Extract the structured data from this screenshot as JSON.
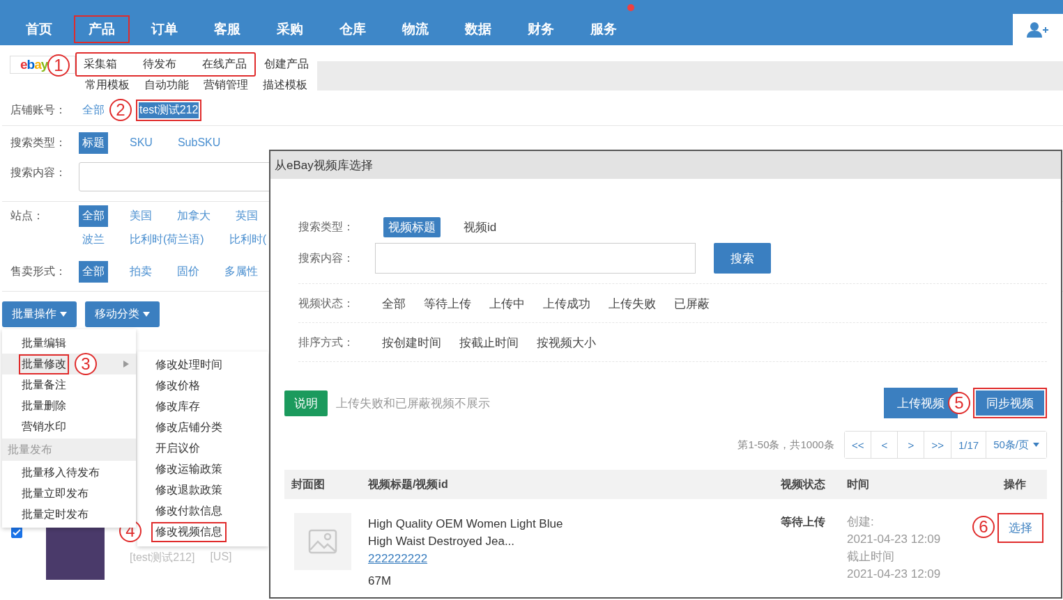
{
  "top_nav": {
    "items": [
      {
        "label": "首页",
        "boxed": false,
        "dot": false
      },
      {
        "label": "产品",
        "boxed": true,
        "dot": false
      },
      {
        "label": "订单",
        "boxed": false,
        "dot": false
      },
      {
        "label": "客服",
        "boxed": false,
        "dot": false
      },
      {
        "label": "采购",
        "boxed": false,
        "dot": false
      },
      {
        "label": "仓库",
        "boxed": false,
        "dot": false
      },
      {
        "label": "物流",
        "boxed": false,
        "dot": false
      },
      {
        "label": "数据",
        "boxed": false,
        "dot": false
      },
      {
        "label": "财务",
        "boxed": false,
        "dot": false
      },
      {
        "label": "服务",
        "boxed": false,
        "dot": true
      }
    ]
  },
  "platform_logo": "ebay",
  "sub_nav": {
    "callout": "1",
    "rows": [
      [
        {
          "label": "采集箱",
          "boxed": true
        },
        {
          "label": "待发布",
          "boxed": true
        },
        {
          "label": "在线产品",
          "boxed": true
        },
        {
          "label": "创建产品",
          "boxed": false
        }
      ],
      [
        {
          "label": "常用模板",
          "boxed": false
        },
        {
          "label": "自动功能",
          "boxed": false
        },
        {
          "label": "营销管理",
          "boxed": false
        },
        {
          "label": "描述模板",
          "boxed": false
        }
      ]
    ]
  },
  "filters": [
    {
      "kind": "options",
      "label": "店铺账号：",
      "option_rows": [
        [
          {
            "text": "全部",
            "selected": false,
            "boxed": false
          },
          {
            "text": "test测试212",
            "selected": true,
            "boxed": true,
            "callout": "2"
          }
        ]
      ]
    },
    {
      "kind": "options",
      "label": "搜索类型：",
      "option_rows": [
        [
          {
            "text": "标题",
            "selected": true,
            "boxed": false
          },
          {
            "text": "SKU",
            "selected": false,
            "boxed": false
          },
          {
            "text": "SubSKU",
            "selected": false,
            "boxed": false
          }
        ]
      ]
    },
    {
      "kind": "input",
      "label": "搜索内容："
    },
    {
      "kind": "options",
      "label": "站点：",
      "option_rows": [
        [
          {
            "text": "全部",
            "selected": true,
            "boxed": false
          },
          {
            "text": "美国",
            "selected": false,
            "boxed": false
          },
          {
            "text": "加拿大",
            "selected": false,
            "boxed": false
          },
          {
            "text": "英国",
            "selected": false,
            "boxed": false
          }
        ],
        [
          {
            "text": "波兰",
            "selected": false,
            "boxed": false
          },
          {
            "text": "比利时(荷兰语)",
            "selected": false,
            "boxed": false
          },
          {
            "text": "比利时(",
            "selected": false,
            "boxed": false
          }
        ]
      ]
    },
    {
      "kind": "options",
      "label": "售卖形式：",
      "option_rows": [
        [
          {
            "text": "全部",
            "selected": true,
            "boxed": false
          },
          {
            "text": "拍卖",
            "selected": false,
            "boxed": false
          },
          {
            "text": "固价",
            "selected": false,
            "boxed": false
          },
          {
            "text": "多属性",
            "selected": false,
            "boxed": false
          }
        ]
      ]
    }
  ],
  "bulk_buttons": [
    {
      "label": "批量操作"
    },
    {
      "label": "移动分类"
    }
  ],
  "bulk_menu": {
    "items": [
      {
        "kind": "item",
        "text": "批量编辑",
        "highlighted": false,
        "boxed": false,
        "submenu": false
      },
      {
        "kind": "item",
        "text": "批量修改",
        "highlighted": true,
        "boxed": true,
        "submenu": true,
        "callout": "3"
      },
      {
        "kind": "item",
        "text": "批量备注",
        "highlighted": false,
        "boxed": false,
        "submenu": false
      },
      {
        "kind": "item",
        "text": "批量删除",
        "highlighted": false,
        "boxed": false,
        "submenu": false
      },
      {
        "kind": "item",
        "text": "营销水印",
        "highlighted": false,
        "boxed": false,
        "submenu": false
      },
      {
        "kind": "header",
        "text": "批量发布"
      },
      {
        "kind": "item",
        "text": "批量移入待发布",
        "highlighted": false,
        "boxed": false,
        "submenu": false
      },
      {
        "kind": "item",
        "text": "批量立即发布",
        "highlighted": false,
        "boxed": false,
        "submenu": false
      },
      {
        "kind": "item",
        "text": "批量定时发布",
        "highlighted": false,
        "boxed": false,
        "submenu": false
      }
    ]
  },
  "submenu": {
    "items": [
      {
        "text": "修改处理时间",
        "boxed": false
      },
      {
        "text": "修改价格",
        "boxed": false
      },
      {
        "text": "修改库存",
        "boxed": false
      },
      {
        "text": "修改店铺分类",
        "boxed": false
      },
      {
        "text": "开启议价",
        "boxed": false
      },
      {
        "text": "修改运输政策",
        "boxed": false
      },
      {
        "text": "修改退款政策",
        "boxed": false
      },
      {
        "text": "修改付款信息",
        "boxed": false
      },
      {
        "text": "修改视频信息",
        "boxed": true,
        "callout": "4"
      }
    ]
  },
  "product_row": {
    "checked": true,
    "tags": [
      "[test测试212]",
      "[US]"
    ]
  },
  "dialog": {
    "title": "从eBay视频库选择",
    "search_type": {
      "label": "搜索类型：",
      "options": [
        {
          "text": "视频标题",
          "selected": true
        },
        {
          "text": "视频id",
          "selected": false
        }
      ]
    },
    "search_content": {
      "label": "搜索内容：",
      "button": "搜索"
    },
    "status_filter": {
      "label": "视频状态：",
      "options": [
        {
          "text": "全部",
          "selected": false
        },
        {
          "text": "等待上传",
          "selected": false
        },
        {
          "text": "上传中",
          "selected": false
        },
        {
          "text": "上传成功",
          "selected": false
        },
        {
          "text": "上传失败",
          "selected": false
        },
        {
          "text": "已屏蔽",
          "selected": false
        }
      ]
    },
    "sort_filter": {
      "label": "排序方式：",
      "options": [
        {
          "text": "按创建时间",
          "selected": false
        },
        {
          "text": "按截止时间",
          "selected": false
        },
        {
          "text": "按视频大小",
          "selected": false
        }
      ]
    },
    "notice": {
      "badge": "说明",
      "text": "上传失败和已屏蔽视频不展示"
    },
    "actions": [
      {
        "label": "上传视频",
        "boxed": false
      },
      {
        "label": "同步视频",
        "boxed": true,
        "callout": "5"
      }
    ],
    "pagination": {
      "summary": "第1-50条，共1000条",
      "buttons": [
        "<<",
        "<",
        ">",
        ">>"
      ],
      "page": "1/17",
      "page_size": "50条/页"
    },
    "table": {
      "columns": [
        "封面图",
        "视频标题/视频id",
        "视频状态",
        "时间",
        "操作"
      ],
      "rows": [
        {
          "title": "High Quality OEM Women Light Blue High Waist Destroyed Jea...",
          "video_id": "222222222",
          "size": "67M",
          "status": "等待上传",
          "created_label": "创建:",
          "created": "2021-04-23 12:09",
          "deadline_label": "截止时间",
          "deadline": "2021-04-23 12:09",
          "action": "选择",
          "action_boxed": true,
          "callout": "6"
        }
      ]
    }
  }
}
